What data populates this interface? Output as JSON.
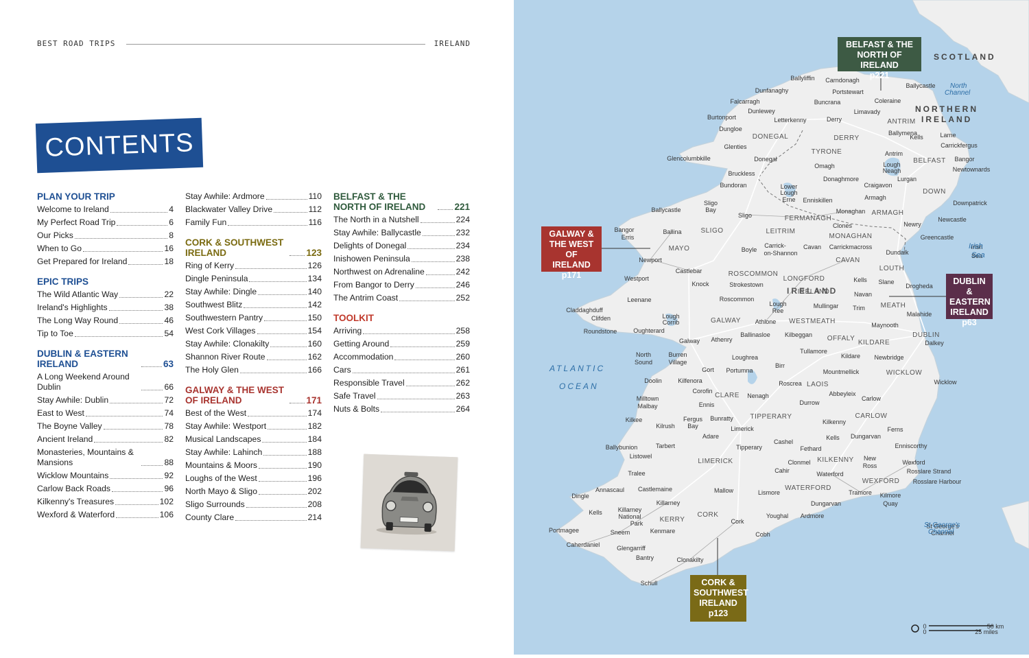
{
  "header": {
    "left": "BEST ROAD TRIPS",
    "right": "IRELAND"
  },
  "banner": "CONTENTS",
  "columns": [
    [
      {
        "title": "PLAN YOUR TRIP",
        "page": "",
        "color": "#1e4f93",
        "items": [
          [
            "Welcome to Ireland",
            "4"
          ],
          [
            "My Perfect Road Trip",
            "6"
          ],
          [
            "Our Picks",
            "8"
          ],
          [
            "When to Go",
            "16"
          ],
          [
            "Get Prepared for Ireland",
            "18"
          ]
        ]
      },
      {
        "title": "EPIC TRIPS",
        "page": "",
        "color": "#1e4f93",
        "items": [
          [
            "The Wild Atlantic Way",
            "22"
          ],
          [
            "Ireland's Highlights",
            "38"
          ],
          [
            "The Long Way Round",
            "46"
          ],
          [
            "Tip to Toe",
            "54"
          ]
        ]
      },
      {
        "title": "DUBLIN & EASTERN IRELAND",
        "page": "63",
        "color": "#1e4f93",
        "items": [
          [
            "A Long Weekend Around Dublin",
            "66"
          ],
          [
            "Stay Awhile: Dublin",
            "72"
          ],
          [
            "East to West",
            "74"
          ],
          [
            "The Boyne Valley",
            "78"
          ],
          [
            "Ancient Ireland",
            "82"
          ],
          [
            "Monasteries, Mountains & Mansions",
            "88"
          ],
          [
            "Wicklow Mountains",
            "92"
          ],
          [
            "Carlow Back Roads",
            "96"
          ],
          [
            "Kilkenny's Treasures",
            "102"
          ],
          [
            "Wexford & Waterford",
            "106"
          ]
        ]
      }
    ],
    [
      {
        "title": "",
        "page": "",
        "color": "#222",
        "items": [
          [
            "Stay Awhile: Ardmore",
            "110"
          ],
          [
            "Blackwater Valley Drive",
            "112"
          ],
          [
            "Family Fun",
            "116"
          ]
        ]
      },
      {
        "title": "CORK & SOUTHWEST IRELAND",
        "page": "123",
        "color": "#7a6a10",
        "items": [
          [
            "Ring of Kerry",
            "126"
          ],
          [
            "Dingle Peninsula",
            "134"
          ],
          [
            "Stay Awhile: Dingle",
            "140"
          ],
          [
            "Southwest Blitz",
            "142"
          ],
          [
            "Southwestern Pantry",
            "150"
          ],
          [
            "West Cork Villages",
            "154"
          ],
          [
            "Stay Awhile: Clonakilty",
            "160"
          ],
          [
            "Shannon River Route",
            "162"
          ],
          [
            "The Holy Glen",
            "166"
          ]
        ]
      },
      {
        "title": "GALWAY & THE WEST OF IRELAND",
        "page": "171",
        "color": "#a8342f",
        "items": [
          [
            "Best of the West",
            "174"
          ],
          [
            "Stay Awhile: Westport",
            "182"
          ],
          [
            "Musical Landscapes",
            "184"
          ],
          [
            "Stay Awhile: Lahinch",
            "188"
          ],
          [
            "Mountains & Moors",
            "190"
          ],
          [
            "Loughs of the West",
            "196"
          ],
          [
            "North Mayo & Sligo",
            "202"
          ],
          [
            "Sligo Surrounds",
            "208"
          ],
          [
            "County Clare",
            "214"
          ]
        ]
      }
    ],
    [
      {
        "title": "BELFAST & THE NORTH OF IRELAND",
        "page": "221",
        "color": "#2f5a3c",
        "items": [
          [
            "The North in a Nutshell",
            "224"
          ],
          [
            "Stay Awhile: Ballycastle",
            "232"
          ],
          [
            "Delights of Donegal",
            "234"
          ],
          [
            "Inishowen Peninsula",
            "238"
          ],
          [
            "Northwest on Adrenaline",
            "242"
          ],
          [
            "From Bangor to Derry",
            "246"
          ],
          [
            "The Antrim Coast",
            "252"
          ]
        ]
      },
      {
        "title": "TOOLKIT",
        "page": "",
        "color": "#c0392b",
        "items": [
          [
            "Arriving",
            "258"
          ],
          [
            "Getting Around",
            "259"
          ],
          [
            "Accommodation",
            "260"
          ],
          [
            "Cars",
            "261"
          ],
          [
            "Responsible Travel",
            "262"
          ],
          [
            "Safe Travel",
            "263"
          ],
          [
            "Nuts & Bolts",
            "264"
          ]
        ]
      }
    ]
  ],
  "map": {
    "region_labels": {
      "belfast": [
        "BELFAST & THE",
        "NORTH OF IRELAND",
        "p221"
      ],
      "galway": [
        "GALWAY &",
        "THE WEST OF",
        "IRELAND",
        "p171"
      ],
      "dublin": [
        "DUBLIN &",
        "EASTERN",
        "IRELAND",
        "p63"
      ],
      "cork": [
        "CORK &",
        "SOUTHWEST",
        "IRELAND",
        "p123"
      ]
    },
    "colors": {
      "sea": "#b5d3ea",
      "land": "#efefef",
      "belfast": "#3d5a44",
      "galway": "#a8342f",
      "dublin": "#5b2e4a",
      "cork": "#7a6a17"
    },
    "sea_labels": [
      "SCOTLAND",
      "NORTHERN",
      "IRELAND",
      "North",
      "Channel",
      "Irish",
      "Sea",
      "ATLANTIC",
      "OCEAN",
      "St George's",
      "Channel",
      "IRELAND"
    ],
    "places": [
      [
        "Ballyliffin",
        1170,
        113
      ],
      [
        "Carndonagh",
        1228,
        116
      ],
      [
        "Dunfanaghy",
        1125,
        131
      ],
      [
        "Portstewart",
        1236,
        133
      ],
      [
        "Ballycastle",
        1342,
        124
      ],
      [
        "Falcarragh",
        1086,
        147
      ],
      [
        "Buncrana",
        1206,
        148
      ],
      [
        "Coleraine",
        1294,
        146
      ],
      [
        "Dunlewey",
        1110,
        161
      ],
      [
        "Limavady",
        1264,
        162
      ],
      [
        "Burtonport",
        1052,
        170
      ],
      [
        "Letterkenny",
        1152,
        174
      ],
      [
        "Derry",
        1216,
        173
      ],
      [
        "ANTRIM",
        1314,
        176
      ],
      [
        "Dungloe",
        1065,
        187
      ],
      [
        "Ballymena",
        1316,
        193
      ],
      [
        "Kells",
        1336,
        199
      ],
      [
        "Larne",
        1382,
        196
      ],
      [
        "DONEGAL",
        1123,
        198
      ],
      [
        "DERRY",
        1234,
        200
      ],
      [
        "Carrickfergus",
        1398,
        211
      ],
      [
        "Glenties",
        1072,
        213
      ],
      [
        "TYRONE",
        1205,
        220
      ],
      [
        "Antrim",
        1303,
        223
      ],
      [
        "Glencolumbkille",
        1004,
        230
      ],
      [
        "Donegal",
        1116,
        231
      ],
      [
        "BELFAST",
        1355,
        233
      ],
      [
        "Bangor",
        1406,
        231
      ],
      [
        "Lough",
        1300,
        239
      ],
      [
        "Neagh",
        1300,
        248
      ],
      [
        "Omagh",
        1202,
        241
      ],
      [
        "Newtownards",
        1416,
        246
      ],
      [
        "Bruckless",
        1081,
        252
      ],
      [
        "Donaghmore",
        1226,
        260
      ],
      [
        "Lurgan",
        1322,
        260
      ],
      [
        "Bundoran",
        1069,
        269
      ],
      [
        "Craigavon",
        1280,
        269
      ],
      [
        "Lower",
        1150,
        271
      ],
      [
        "Lough",
        1150,
        280
      ],
      [
        "DOWN",
        1362,
        278
      ],
      [
        "Erne",
        1150,
        290
      ],
      [
        "Enniskillen",
        1192,
        291
      ],
      [
        "Armagh",
        1276,
        287
      ],
      [
        "Downpatrick",
        1414,
        295
      ],
      [
        "Sligo",
        1036,
        295
      ],
      [
        "Bay",
        1036,
        305
      ],
      [
        "Ballycastle",
        971,
        305
      ],
      [
        "Monaghan",
        1240,
        307
      ],
      [
        "ARMAGH",
        1294,
        309
      ],
      [
        "Sligo",
        1086,
        313
      ],
      [
        "FERMANAGH",
        1178,
        317
      ],
      [
        "Newcastle",
        1388,
        319
      ],
      [
        "Bangor",
        910,
        334
      ],
      [
        "Erris",
        915,
        345
      ],
      [
        "Ballina",
        980,
        337
      ],
      [
        "LEITRIM",
        1138,
        336
      ],
      [
        "Clones",
        1228,
        328
      ],
      [
        "Newry",
        1330,
        326
      ],
      [
        "SLIGO",
        1038,
        335
      ],
      [
        "MONAGHAN",
        1240,
        343
      ],
      [
        "Greencastle",
        1366,
        345
      ],
      [
        "Carrick-",
        1130,
        357
      ],
      [
        "on-Shannon",
        1138,
        368
      ],
      [
        "Cavan",
        1184,
        359
      ],
      [
        "Carrickmacross",
        1240,
        359
      ],
      [
        "MAYO",
        990,
        361
      ],
      [
        "Boyle",
        1092,
        363
      ],
      [
        "Dundalk",
        1308,
        367
      ],
      [
        "Irish",
        1424,
        359
      ],
      [
        "Sea",
        1424,
        372
      ],
      [
        "CAVAN",
        1236,
        378
      ],
      [
        "Newport",
        948,
        378
      ],
      [
        "LOUTH",
        1300,
        390
      ],
      [
        "Castlebar",
        1004,
        394
      ],
      [
        "ROSCOMMON",
        1098,
        398
      ],
      [
        "LONGFORD",
        1172,
        405
      ],
      [
        "Westport",
        928,
        405
      ],
      [
        "Kells",
        1254,
        407
      ],
      [
        "Slane",
        1292,
        410
      ],
      [
        "Drogheda",
        1340,
        416
      ],
      [
        "Knock",
        1021,
        413
      ],
      [
        "Strokestown",
        1088,
        414
      ],
      [
        "IRELAND",
        1186,
        424
      ],
      [
        "Navan",
        1258,
        428
      ],
      [
        "Leenane",
        932,
        436
      ],
      [
        "Roscommon",
        1074,
        435
      ],
      [
        "MEATH",
        1302,
        444
      ],
      [
        "Lough",
        1134,
        442
      ],
      [
        "Ree",
        1134,
        452
      ],
      [
        "Mullingar",
        1204,
        445
      ],
      [
        "Trim",
        1252,
        448
      ],
      [
        "Claddaghduff",
        852,
        451
      ],
      [
        "Clifden",
        876,
        463
      ],
      [
        "Malahide",
        1340,
        457
      ],
      [
        "Lough",
        978,
        460
      ],
      [
        "Corrib",
        978,
        469
      ],
      [
        "GALWAY",
        1058,
        466
      ],
      [
        "Athlone",
        1116,
        468
      ],
      [
        "WESTMEATH",
        1184,
        467
      ],
      [
        "Maynooth",
        1290,
        473
      ],
      [
        "Roundstone",
        875,
        482
      ],
      [
        "Oughterard",
        946,
        481
      ],
      [
        "Ballinasloe",
        1101,
        487
      ],
      [
        "Kilbeggan",
        1164,
        487
      ],
      [
        "DUBLIN",
        1350,
        487
      ],
      [
        "OFFALY",
        1226,
        492
      ],
      [
        "Galway",
        1005,
        496
      ],
      [
        "Athenry",
        1052,
        494
      ],
      [
        "KILDARE",
        1274,
        498
      ],
      [
        "Dalkey",
        1362,
        499
      ],
      [
        "Burren",
        988,
        516
      ],
      [
        "Village",
        988,
        527
      ],
      [
        "Tullamore",
        1186,
        511
      ],
      [
        "North",
        938,
        516
      ],
      [
        "Sound",
        938,
        527
      ],
      [
        "Kildare",
        1240,
        518
      ],
      [
        "Newbridge",
        1296,
        520
      ],
      [
        "Loughrea",
        1086,
        520
      ],
      [
        "Birr",
        1137,
        532
      ],
      [
        "Gort",
        1032,
        538
      ],
      [
        "Portumna",
        1078,
        539
      ],
      [
        "Mountmellick",
        1226,
        541
      ],
      [
        "WICKLOW",
        1318,
        542
      ],
      [
        "Doolin",
        952,
        554
      ],
      [
        "Kilfenora",
        1006,
        554
      ],
      [
        "Roscrea",
        1152,
        558
      ],
      [
        "LAOIS",
        1192,
        559
      ],
      [
        "Wicklow",
        1378,
        556
      ],
      [
        "Corofin",
        1024,
        569
      ],
      [
        "Abbeyleix",
        1228,
        573
      ],
      [
        "CLARE",
        1060,
        575
      ],
      [
        "Nenagh",
        1105,
        576
      ],
      [
        "Carlow",
        1270,
        580
      ],
      [
        "Milltown",
        944,
        580
      ],
      [
        "Malbay",
        944,
        591
      ],
      [
        "Ennis",
        1030,
        589
      ],
      [
        "Durrow",
        1180,
        586
      ],
      [
        "TIPPERARY",
        1124,
        606
      ],
      [
        "CARLOW",
        1270,
        605
      ],
      [
        "Fergus",
        1010,
        610
      ],
      [
        "Bay",
        1010,
        620
      ],
      [
        "Bunratty",
        1052,
        609
      ],
      [
        "Kilrush",
        970,
        620
      ],
      [
        "Kilkee",
        924,
        611
      ],
      [
        "Limerick",
        1082,
        624
      ],
      [
        "Kilkenny",
        1216,
        614
      ],
      [
        "Ferns",
        1305,
        625
      ],
      [
        "Adare",
        1036,
        635
      ],
      [
        "Kells",
        1214,
        637
      ],
      [
        "Dungarvan",
        1262,
        635
      ],
      [
        "Cashel",
        1142,
        643
      ],
      [
        "Enniscorthy",
        1328,
        649
      ],
      [
        "Ballybunion",
        906,
        651
      ],
      [
        "Tarbert",
        970,
        649
      ],
      [
        "Tipperary",
        1092,
        651
      ],
      [
        "Fethard",
        1182,
        653
      ],
      [
        "Listowel",
        934,
        664
      ],
      [
        "KILKENNY",
        1218,
        669
      ],
      [
        "New",
        1268,
        667
      ],
      [
        "Ross",
        1268,
        678
      ],
      [
        "LIMERICK",
        1043,
        671
      ],
      [
        "Clonmel",
        1165,
        673
      ],
      [
        "Wexford",
        1332,
        673
      ],
      [
        "Cahir",
        1140,
        685
      ],
      [
        "Rosslare Strand",
        1354,
        686
      ],
      [
        "Tralee",
        928,
        689
      ],
      [
        "Waterford",
        1210,
        690
      ],
      [
        "WEXFORD",
        1284,
        700
      ],
      [
        "Rosslare Harbour",
        1366,
        701
      ],
      [
        "Annascaul",
        889,
        713
      ],
      [
        "Castlemaine",
        955,
        712
      ],
      [
        "Mallow",
        1055,
        714
      ],
      [
        "Lismore",
        1121,
        717
      ],
      [
        "WATERFORD",
        1178,
        710
      ],
      [
        "Tramore",
        1254,
        717
      ],
      [
        "Kilmore",
        1298,
        721
      ],
      [
        "Quay",
        1298,
        733
      ],
      [
        "Dingle",
        846,
        722
      ],
      [
        "Killarney",
        974,
        732
      ],
      [
        "Dungarvan",
        1204,
        733
      ],
      [
        "Killarney",
        918,
        742
      ],
      [
        "National",
        918,
        752
      ],
      [
        "Park",
        928,
        762
      ],
      [
        "Kells",
        868,
        746
      ],
      [
        "CORK",
        1032,
        749
      ],
      [
        "Youghal",
        1133,
        751
      ],
      [
        "Ardmore",
        1184,
        751
      ],
      [
        "KERRY",
        980,
        756
      ],
      [
        "Cork",
        1075,
        759
      ],
      [
        "St George's",
        1374,
        766
      ],
      [
        "Channel",
        1374,
        776
      ],
      [
        "Portmagee",
        822,
        772
      ],
      [
        "Sneem",
        904,
        775
      ],
      [
        "Kenmare",
        966,
        773
      ],
      [
        "Cobh",
        1112,
        778
      ],
      [
        "Caherdaniel",
        850,
        793
      ],
      [
        "Glengarriff",
        920,
        798
      ],
      [
        "Bantry",
        940,
        812
      ],
      [
        "Clonakilty",
        1006,
        815
      ],
      [
        "Schull",
        946,
        849
      ],
      [
        "50 km",
        1451,
        912
      ],
      [
        "25 miles",
        1438,
        920
      ],
      [
        "0",
        1348,
        912
      ],
      [
        "0",
        1348,
        920
      ]
    ]
  }
}
